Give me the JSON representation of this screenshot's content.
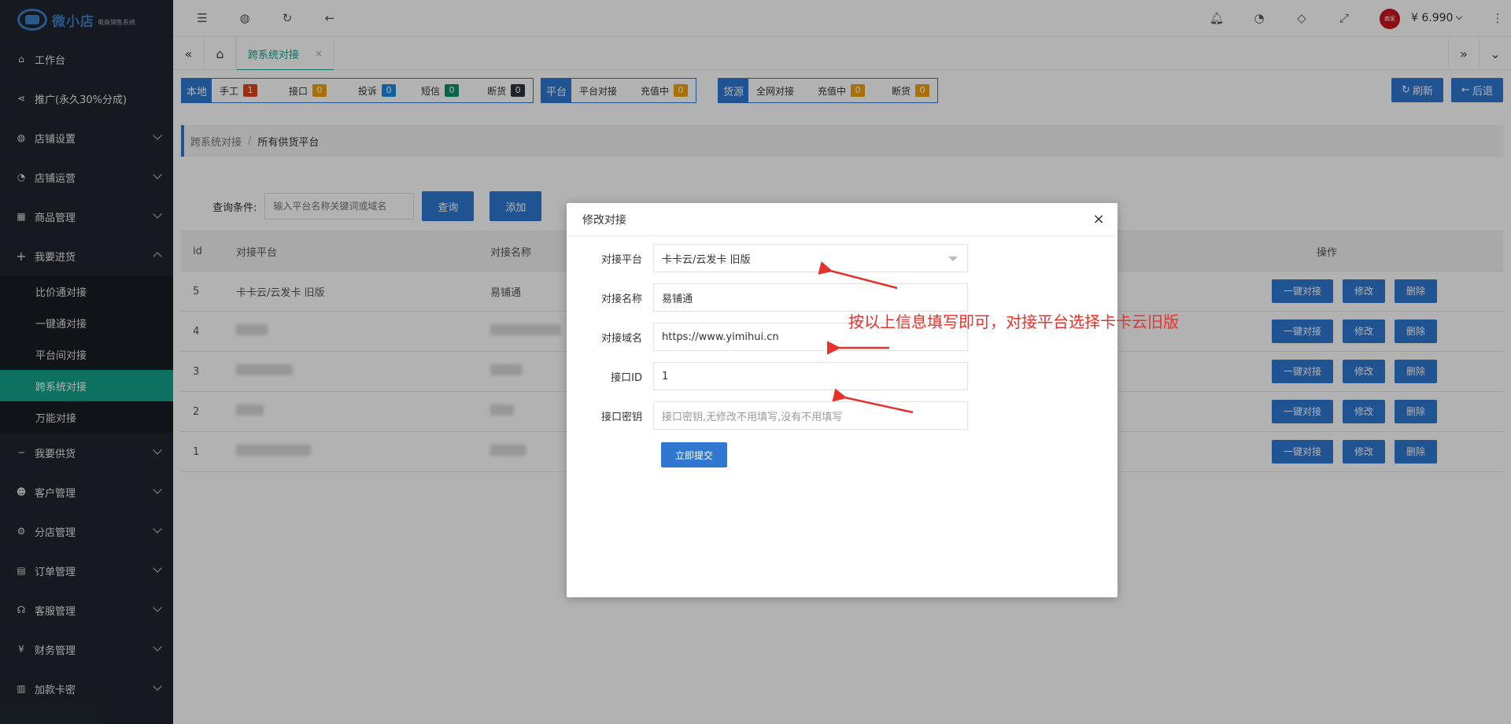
{
  "logo": {
    "name": "微小店",
    "sub": "电商销售系统"
  },
  "sidebar": {
    "items": [
      {
        "label": "工作台",
        "icon": "home-icon",
        "chevron": false
      },
      {
        "label": "推广(永久30%分成)",
        "icon": "share-icon",
        "chevron": false
      },
      {
        "label": "店铺设置",
        "icon": "globe-icon",
        "chevron": true
      },
      {
        "label": "店铺运营",
        "icon": "gauge-icon",
        "chevron": true
      },
      {
        "label": "商品管理",
        "icon": "grid-icon",
        "chevron": true
      },
      {
        "label": "我要进货",
        "icon": "plus-icon",
        "chevron": true,
        "expanded": true
      }
    ],
    "subitems": [
      "比价通对接",
      "一键通对接",
      "平台间对接",
      "跨系统对接",
      "万能对接"
    ],
    "active_sub": "跨系统对接",
    "items_after": [
      {
        "label": "我要供货",
        "icon": "minus-icon"
      },
      {
        "label": "客户管理",
        "icon": "users-icon"
      },
      {
        "label": "分店管理",
        "icon": "gear-icon"
      },
      {
        "label": "订单管理",
        "icon": "document-icon"
      },
      {
        "label": "客服管理",
        "icon": "headset-icon"
      },
      {
        "label": "财务管理",
        "icon": "yen-icon"
      },
      {
        "label": "加款卡密",
        "icon": "calendar-icon"
      }
    ]
  },
  "topbar": {
    "balance": "¥ 6.990",
    "avatar_text": "商家"
  },
  "tabs": {
    "active": "跨系统对接",
    "close": "×"
  },
  "stats": {
    "local": {
      "head": "本地",
      "items": [
        {
          "label": "手工",
          "value": "1",
          "color": "#e0431a"
        },
        {
          "label": "接口",
          "value": "0",
          "color": "#f1a10a"
        },
        {
          "label": "投诉",
          "value": "0",
          "color": "#1e88e5"
        },
        {
          "label": "短信",
          "value": "0",
          "color": "#0c8f6b"
        },
        {
          "label": "断货",
          "value": "0",
          "color": "#2d3440"
        }
      ]
    },
    "platform": {
      "head": "平台",
      "items": [
        {
          "label": "平台对接",
          "value": ""
        },
        {
          "label": "充值中",
          "value": "0",
          "color": "#f1a10a"
        }
      ]
    },
    "source": {
      "head": "货源",
      "items": [
        {
          "label": "全网对接",
          "value": ""
        },
        {
          "label": "充值中",
          "value": "0",
          "color": "#f1a10a"
        },
        {
          "label": "断货",
          "value": "0",
          "color": "#f1a10a"
        }
      ]
    },
    "refresh_label": "刷新",
    "back_label": "后退"
  },
  "breadcrumb": {
    "parent": "跨系统对接",
    "current": "所有供货平台",
    "sep": "/"
  },
  "query": {
    "label": "查询条件:",
    "placeholder": "输入平台名称关键词或域名",
    "search_label": "查询",
    "add_label": "添加"
  },
  "table": {
    "headers": {
      "id": "id",
      "platform": "对接平台",
      "name": "对接名称",
      "ops": "操作"
    },
    "rows": [
      {
        "id": "5",
        "platform": "卡卡云/云发卡 旧版",
        "name": "易铺通"
      },
      {
        "id": "4",
        "platform": "",
        "name": ""
      },
      {
        "id": "3",
        "platform": "",
        "name": ""
      },
      {
        "id": "2",
        "platform": "",
        "name": ""
      },
      {
        "id": "1",
        "platform": "",
        "name": ""
      }
    ],
    "actions": {
      "one_click": "一键对接",
      "edit": "修改",
      "delete": "删除"
    }
  },
  "modal": {
    "title": "修改对接",
    "close": "×",
    "fields": {
      "platform_label": "对接平台",
      "platform_value": "卡卡云/云发卡 旧版",
      "name_label": "对接名称",
      "name_value": "易铺通",
      "domain_label": "对接域名",
      "domain_value": "https://www.yimihui.cn",
      "id_label": "接口ID",
      "id_value": "1",
      "secret_label": "接口密钥",
      "secret_placeholder": "接口密钥,无修改不用填写,没有不用填写"
    },
    "submit_label": "立即提交"
  },
  "annotation": "按以上信息填写即可，对接平台选择卡卡云旧版",
  "colors": {
    "accent": "#2f77d0",
    "active": "#14a38b",
    "sidebar": "#20262e",
    "annotation": "#e6322d"
  }
}
